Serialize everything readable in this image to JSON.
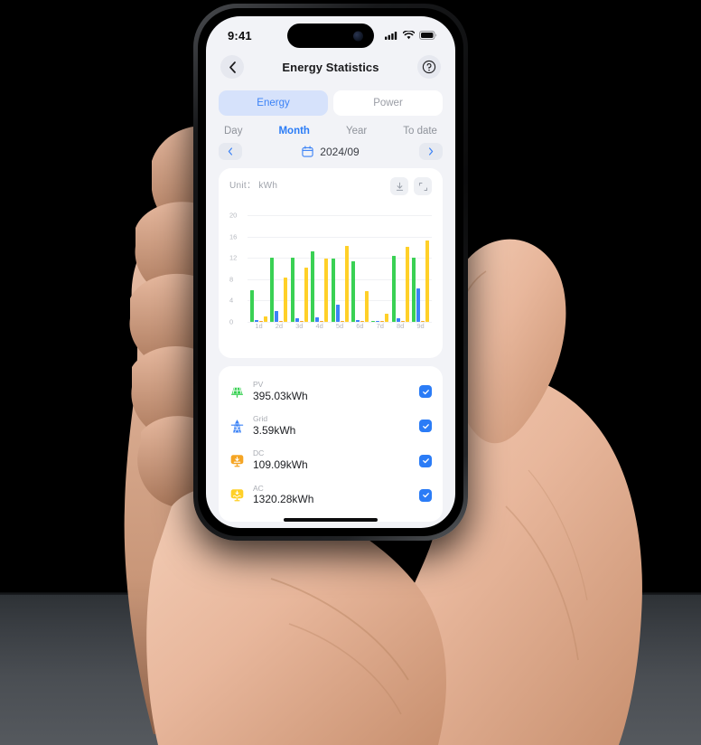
{
  "status_bar": {
    "time": "9:41",
    "icons": [
      "cellular-signal-icon",
      "wifi-icon",
      "battery-icon"
    ]
  },
  "nav": {
    "back_icon": "chevron-left-icon",
    "title": "Energy Statistics",
    "help_icon": "question-mark-circle-icon"
  },
  "segmented": {
    "options": [
      {
        "label": "Energy",
        "active": true
      },
      {
        "label": "Power",
        "active": false
      }
    ],
    "active_color": "#3b82f6",
    "active_bg": "#d6e2fb"
  },
  "period_tabs": [
    {
      "label": "Day",
      "active": false
    },
    {
      "label": "Month",
      "active": true
    },
    {
      "label": "Year",
      "active": false
    },
    {
      "label": "To date",
      "active": false
    }
  ],
  "date_nav": {
    "prev_icon": "chevron-left-icon",
    "next_icon": "chevron-right-icon",
    "calendar_icon": "calendar-icon",
    "value": "2024/09"
  },
  "chart_card": {
    "unit_label": "Unit： kWh",
    "actions": [
      {
        "icon": "download-icon",
        "name": "download-button"
      },
      {
        "icon": "fullscreen-icon",
        "name": "fullscreen-button"
      }
    ]
  },
  "chart_data": {
    "type": "bar",
    "title": "",
    "xlabel": "",
    "ylabel": "kWh",
    "ylim": [
      0,
      20
    ],
    "yticks": [
      0,
      4,
      8,
      12,
      16,
      20
    ],
    "grid": true,
    "legend_position": "below-chart",
    "categories": [
      "1d",
      "2d",
      "3d",
      "4d",
      "5d",
      "6d",
      "7d",
      "8d",
      "9d"
    ],
    "series": [
      {
        "name": "PV",
        "color": "#3ad154",
        "values": [
          6.0,
          12.1,
          12.1,
          13.2,
          11.9,
          11.4,
          0.1,
          12.3,
          12.1
        ]
      },
      {
        "name": "Grid",
        "color": "#3b82f6",
        "values": [
          0.3,
          2.1,
          0.6,
          0.8,
          3.2,
          0.4,
          0.05,
          0.6,
          6.3
        ]
      },
      {
        "name": "DC",
        "color": "#f5a524",
        "values": [
          0.12,
          0.12,
          0.12,
          0.12,
          0.12,
          0.12,
          0.12,
          0.12,
          0.12
        ]
      },
      {
        "name": "AC",
        "color": "#ffd028",
        "values": [
          1.0,
          8.3,
          10.1,
          11.8,
          14.2,
          5.8,
          1.5,
          14.1,
          15.3
        ]
      }
    ]
  },
  "legend": {
    "items": [
      {
        "name": "PV",
        "value": "395.03kWh",
        "icon": "solar-panel-icon",
        "color": "#3ad154",
        "checked": true
      },
      {
        "name": "Grid",
        "value": "3.59kWh",
        "icon": "power-tower-icon",
        "color": "#3b82f6",
        "checked": true
      },
      {
        "name": "DC",
        "value": "109.09kWh",
        "icon": "dc-inverter-icon",
        "color": "#f5a524",
        "checked": true
      },
      {
        "name": "AC",
        "value": "1320.28kWh",
        "icon": "ac-inverter-icon",
        "color": "#ffd028",
        "checked": true
      }
    ],
    "check_color": "#2b7cf6",
    "check_icon": "checkmark-icon"
  },
  "home_indicator": "home-indicator-bar"
}
